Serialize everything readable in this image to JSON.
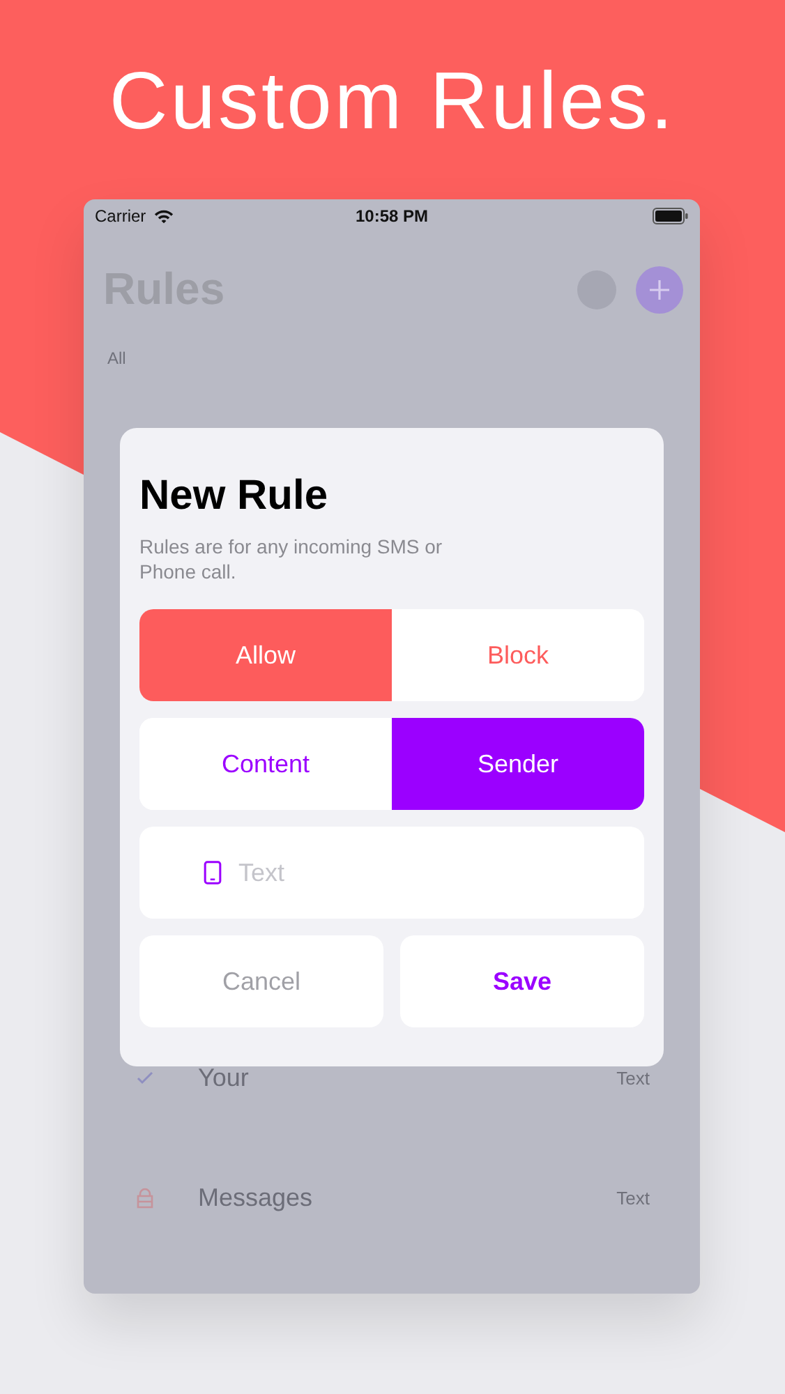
{
  "headline": "Custom Rules.",
  "status_bar": {
    "carrier": "Carrier",
    "time": "10:58 PM"
  },
  "screen": {
    "title": "Rules",
    "filters": [
      "All"
    ],
    "rows": [
      {
        "label": "Your",
        "detail": "Text",
        "kind": "check"
      },
      {
        "label": "Messages",
        "detail": "Text",
        "kind": "lock"
      }
    ]
  },
  "dialog": {
    "title": "New Rule",
    "description": "Rules are for any incoming SMS or Phone call.",
    "actions": [
      {
        "label": "Allow",
        "selected": true
      },
      {
        "label": "Block",
        "selected": false
      }
    ],
    "targets": [
      {
        "label": "Content",
        "selected": false
      },
      {
        "label": "Sender",
        "selected": true
      }
    ],
    "field": {
      "placeholder": "Text"
    },
    "buttons": [
      {
        "label": "Cancel",
        "kind": "cancel"
      },
      {
        "label": "Save",
        "kind": "save"
      }
    ]
  }
}
